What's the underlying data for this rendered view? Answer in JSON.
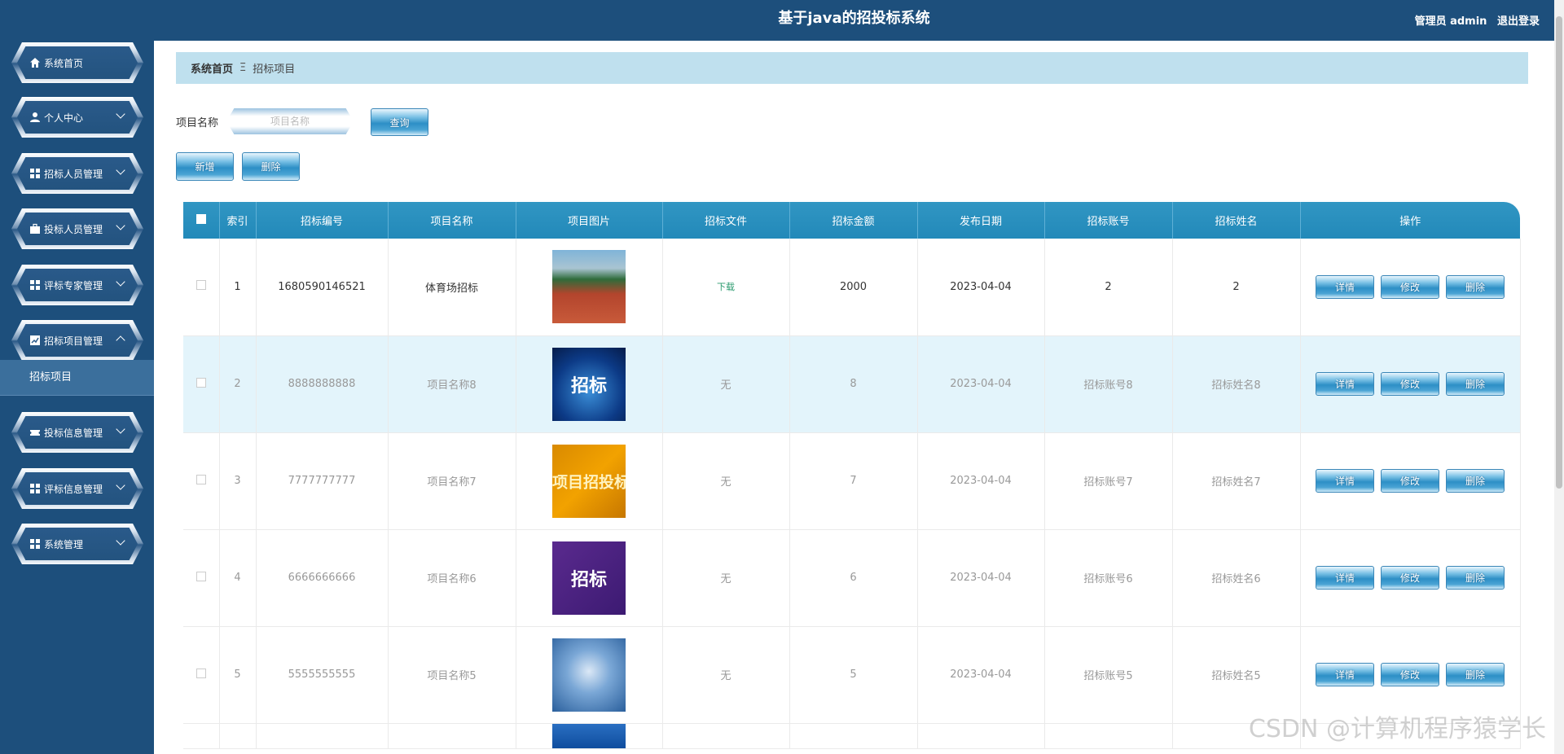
{
  "app": {
    "title": "基于java的招投标系统"
  },
  "header": {
    "user_label": "管理员 admin",
    "logout": "退出登录"
  },
  "sidebar": {
    "items": [
      {
        "label": "系统首页",
        "icon": "home-icon"
      },
      {
        "label": "个人中心",
        "icon": "person-icon"
      },
      {
        "label": "招标人员管理",
        "icon": "grid-icon"
      },
      {
        "label": "投标人员管理",
        "icon": "briefcase-icon"
      },
      {
        "label": "评标专家管理",
        "icon": "grid-icon"
      },
      {
        "label": "招标项目管理",
        "icon": "chart-icon"
      },
      {
        "label": "投标信息管理",
        "icon": "ticket-icon"
      },
      {
        "label": "评标信息管理",
        "icon": "grid-icon"
      },
      {
        "label": "系统管理",
        "icon": "grid-icon"
      }
    ],
    "sub_item": "招标项目"
  },
  "breadcrumb": {
    "home": "系统首页",
    "separator": "Ξ",
    "current": "招标项目"
  },
  "search": {
    "label": "项目名称",
    "placeholder": "项目名称",
    "query_button": "查询"
  },
  "toolbar": {
    "add": "新增",
    "delete": "删除"
  },
  "table": {
    "headers": [
      "索引",
      "招标编号",
      "项目名称",
      "项目图片",
      "招标文件",
      "招标金额",
      "发布日期",
      "招标账号",
      "招标姓名",
      "操作"
    ],
    "actions": {
      "detail": "详情",
      "edit": "修改",
      "delete": "删除"
    },
    "rows": [
      {
        "index": "1",
        "code": "1680590146521",
        "name": "体育场招标",
        "image_text": "",
        "file": "下载",
        "amount": "2000",
        "date": "2023-04-04",
        "account": "2",
        "person": "2"
      },
      {
        "index": "2",
        "code": "8888888888",
        "name": "项目名称8",
        "image_text": "招标",
        "file": "无",
        "amount": "8",
        "date": "2023-04-04",
        "account": "招标账号8",
        "person": "招标姓名8"
      },
      {
        "index": "3",
        "code": "7777777777",
        "name": "项目名称7",
        "image_text": "项目招投标",
        "file": "无",
        "amount": "7",
        "date": "2023-04-04",
        "account": "招标账号7",
        "person": "招标姓名7"
      },
      {
        "index": "4",
        "code": "6666666666",
        "name": "项目名称6",
        "image_text": "招标",
        "file": "无",
        "amount": "6",
        "date": "2023-04-04",
        "account": "招标账号6",
        "person": "招标姓名6"
      },
      {
        "index": "5",
        "code": "5555555555",
        "name": "项目名称5",
        "image_text": "",
        "file": "无",
        "amount": "5",
        "date": "2023-04-04",
        "account": "招标账号5",
        "person": "招标姓名5"
      }
    ]
  },
  "watermark": "CSDN @计算机程序猿学长",
  "colors": {
    "sidebar": "#1d4f7c",
    "table_header": "#2289b9",
    "breadcrumb": "#bfe0ee",
    "row_hover": "#e3f4fb"
  }
}
